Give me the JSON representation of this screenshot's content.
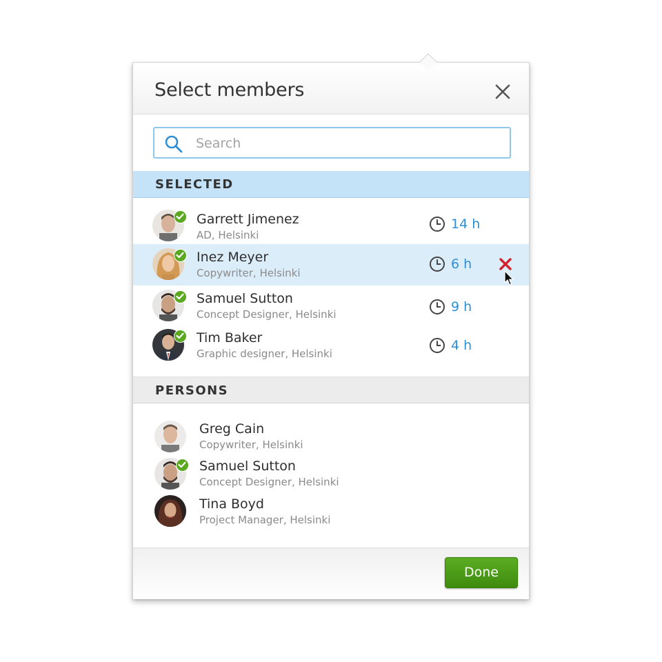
{
  "dialog": {
    "title": "Select members",
    "close_icon": "close-icon",
    "search": {
      "placeholder": "Search",
      "value": "",
      "icon": "search-icon"
    }
  },
  "selected": {
    "heading": "SELECTED",
    "members": [
      {
        "name": "Garrett Jimenez",
        "subtitle": "AD, Helsinki",
        "hours": "14 h",
        "checked": true
      },
      {
        "name": "Inez Meyer",
        "subtitle": "Copywriter, Helsinki",
        "hours": "6 h",
        "checked": true,
        "highlighted": true
      },
      {
        "name": "Samuel Sutton",
        "subtitle": "Concept Designer, Helsinki",
        "hours": "9 h",
        "checked": true
      },
      {
        "name": "Tim Baker",
        "subtitle": "Graphic designer, Helsinki",
        "hours": "4 h",
        "checked": true
      }
    ]
  },
  "persons": {
    "heading": "PERSONS",
    "people": [
      {
        "name": "Greg Cain",
        "subtitle": "Copywriter, Helsinki",
        "checked": false
      },
      {
        "name": "Samuel Sutton",
        "subtitle": "Concept Designer, Helsinki",
        "checked": true
      },
      {
        "name": "Tina Boyd",
        "subtitle": "Project Manager, Helsinki",
        "checked": false
      }
    ]
  },
  "footer": {
    "done_label": "Done"
  },
  "colors": {
    "accent_blue": "#2e8fd6",
    "selected_header_bg": "#c5e3f8",
    "highlight_row_bg": "#dcedfa",
    "check_green": "#5aa921",
    "done_green": "#4c9c18",
    "remove_red": "#d3202a"
  }
}
